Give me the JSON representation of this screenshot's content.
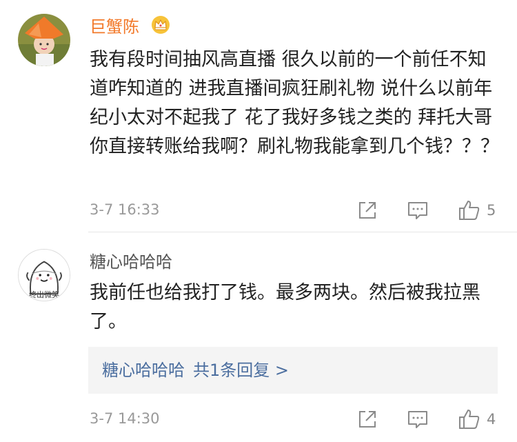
{
  "comments": [
    {
      "username": "巨蟹陈",
      "badge": "crown-icon",
      "text": "我有段时间抽风高直播 很久以前的一个前任不知道咋知道的 进我直播间疯狂刷礼物 说什么以前年纪小太对不起我了 花了我好多钱之类的 拜托大哥 你直接转账给我啊？刷礼物我能拿到几个钱？？？",
      "time": "3-7 16:33",
      "likes": "5",
      "username_color": "#f2792a"
    },
    {
      "username": "糖心哈哈哈",
      "avatar_caption": "终出微笑",
      "text": "我前任也给我打了钱。最多两块。然后被我拉黑了。",
      "time": "3-7 14:30",
      "likes": "4",
      "reply_preview": {
        "author": "糖心哈哈哈",
        "summary": "共1条回复 >"
      },
      "link_color": "#4b6e9f"
    }
  ],
  "icons": {
    "share": "share-icon",
    "reply": "comment-icon",
    "like": "thumbs-up-icon"
  }
}
